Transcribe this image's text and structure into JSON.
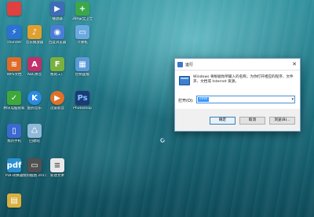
{
  "desktop": {
    "icons": [
      {
        "label": "",
        "color": "#e04040"
      },
      {
        "label": "播放器",
        "color": "#3f6cb8"
      },
      {
        "label": "360安全卫士",
        "color": "#3aa84a"
      },
      {
        "label": "Thunder",
        "color": "#2a72d4"
      },
      {
        "label": "音乐播放器",
        "color": "#e0a030"
      },
      {
        "label": "百度浏览器",
        "color": "#4a7ed6"
      },
      {
        "label": "计算机",
        "color": "#6aa9e0"
      },
      {
        "label": "WPS文档",
        "color": "#e06a28"
      },
      {
        "label": "ABC拼音",
        "color": "#c0306a"
      },
      {
        "label": "格式工厂",
        "color": "#7ab040"
      },
      {
        "label": "控制面板",
        "color": "#5a9ad8"
      },
      {
        "label": "腾讯电脑管家",
        "color": "#3fa83a"
      },
      {
        "label": "酷狗音乐",
        "color": "#2b8ae0"
      },
      {
        "label": "迅雷影音",
        "color": "#e0702a"
      },
      {
        "label": "Photoshop",
        "color": "#1d3a78"
      },
      {
        "label": "我的手机",
        "color": "#3a6ad0"
      },
      {
        "label": "回收站",
        "color": "#90b8d8"
      },
      {
        "label": "PDF转换器",
        "color": "#2a90d0"
      },
      {
        "label": "搜狗截图 20150804",
        "color": "#505050"
      },
      {
        "label": "新建文本",
        "color": "#e8e8e8"
      },
      {
        "label": "",
        "color": "#d8b040"
      }
    ]
  },
  "run_dialog": {
    "title": "运行",
    "description": "Windows 将根据你所输入的名称，为你打开相应的程序、文件夹、文档或 Internet 资源。",
    "open_label": "打开(O):",
    "input_value": "cmd",
    "ok_label": "确定",
    "cancel_label": "取消",
    "browse_label": "浏览(B)...",
    "close_glyph": "✕",
    "dropdown_glyph": "▾"
  }
}
